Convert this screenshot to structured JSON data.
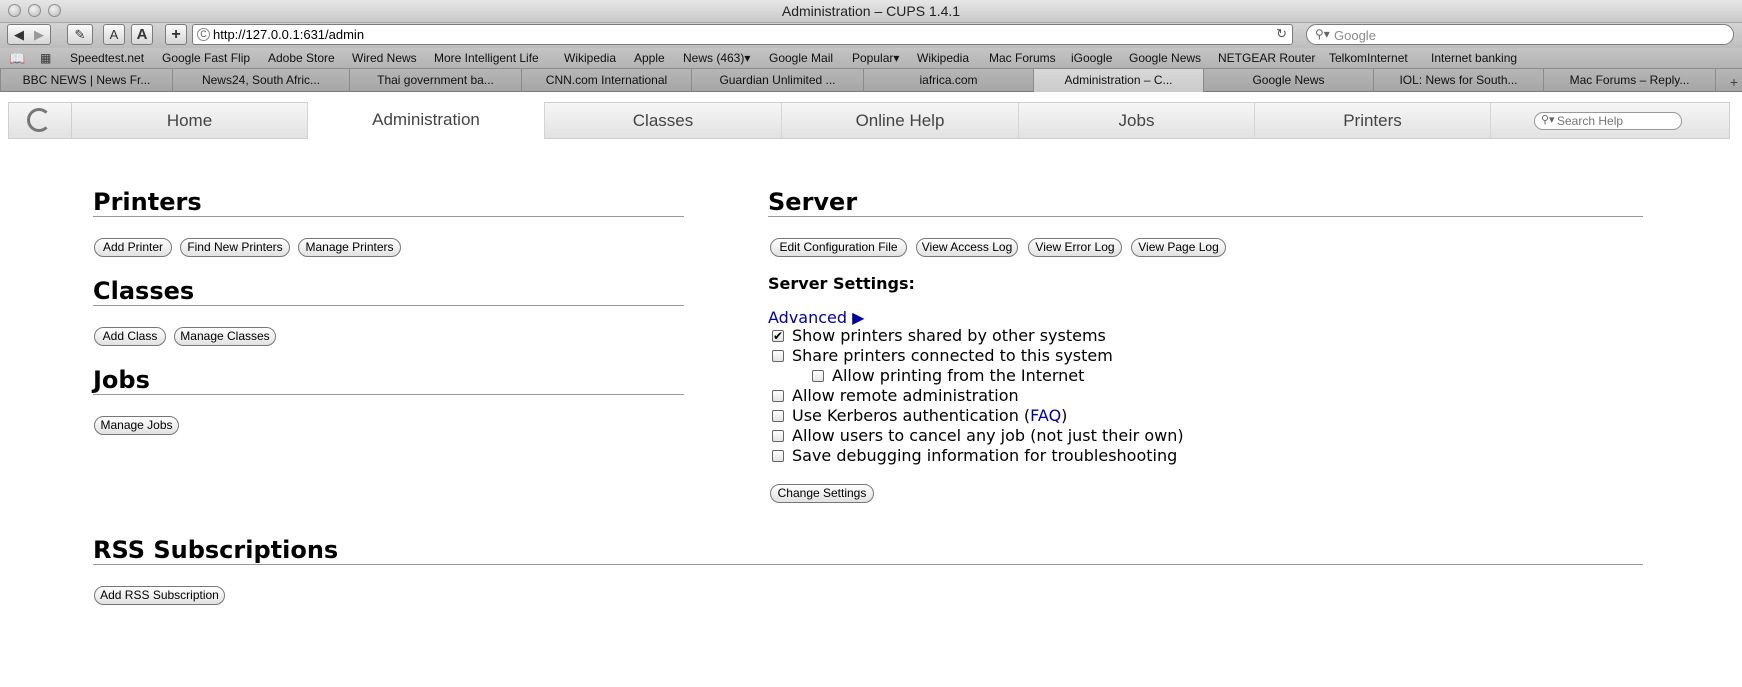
{
  "window": {
    "title": "Administration – CUPS 1.4.1"
  },
  "toolbar": {
    "url": "http://127.0.0.1:631/admin",
    "search_placeholder": "Google",
    "text_smaller": "A",
    "text_larger": "A",
    "add_bookmark": "+"
  },
  "bookmarks": [
    "Speedtest.net",
    "Google Fast Flip",
    "Adobe Store",
    "Wired News",
    "More Intelligent Life",
    "Wikipedia",
    "Apple",
    "News (463)▾",
    "Google Mail",
    "Popular▾",
    "Wikipedia",
    "Mac Forums",
    "iGoogle",
    "Google News",
    "NETGEAR Router",
    "TelkomInternet",
    "Internet banking"
  ],
  "tabs": [
    "BBC NEWS | News Fr...",
    "News24, South Afric...",
    "Thai government ba...",
    "CNN.com International",
    "Guardian Unlimited ...",
    "iafrica.com",
    "Administration – C...",
    "Google News",
    "IOL: News for South...",
    "Mac Forums – Reply..."
  ],
  "cups_nav": {
    "items": [
      "Home",
      "Administration",
      "Classes",
      "Online Help",
      "Jobs",
      "Printers"
    ],
    "search_placeholder": "Search Help"
  },
  "printers": {
    "heading": "Printers",
    "buttons": [
      "Add Printer",
      "Find New Printers",
      "Manage Printers"
    ]
  },
  "classes": {
    "heading": "Classes",
    "buttons": [
      "Add Class",
      "Manage Classes"
    ]
  },
  "jobs": {
    "heading": "Jobs",
    "buttons": [
      "Manage Jobs"
    ]
  },
  "server": {
    "heading": "Server",
    "buttons": [
      "Edit Configuration File",
      "View Access Log",
      "View Error Log",
      "View Page Log"
    ],
    "settings_label": "Server Settings:",
    "advanced_label": "Advanced ▶",
    "options": [
      {
        "label": "Show printers shared by other systems",
        "checked": true
      },
      {
        "label": "Share printers connected to this system",
        "checked": false
      },
      {
        "label": "Allow printing from the Internet",
        "checked": false
      },
      {
        "label": "Allow remote administration",
        "checked": false
      },
      {
        "label_prefix": "Use Kerberos authentication (",
        "link": "FAQ",
        "label_suffix": ")",
        "checked": false
      },
      {
        "label": "Allow users to cancel any job (not just their own)",
        "checked": false
      },
      {
        "label": "Save debugging information for troubleshooting",
        "checked": false
      }
    ],
    "change_button": "Change Settings"
  },
  "rss": {
    "heading": "RSS Subscriptions",
    "button": "Add RSS Subscription"
  }
}
